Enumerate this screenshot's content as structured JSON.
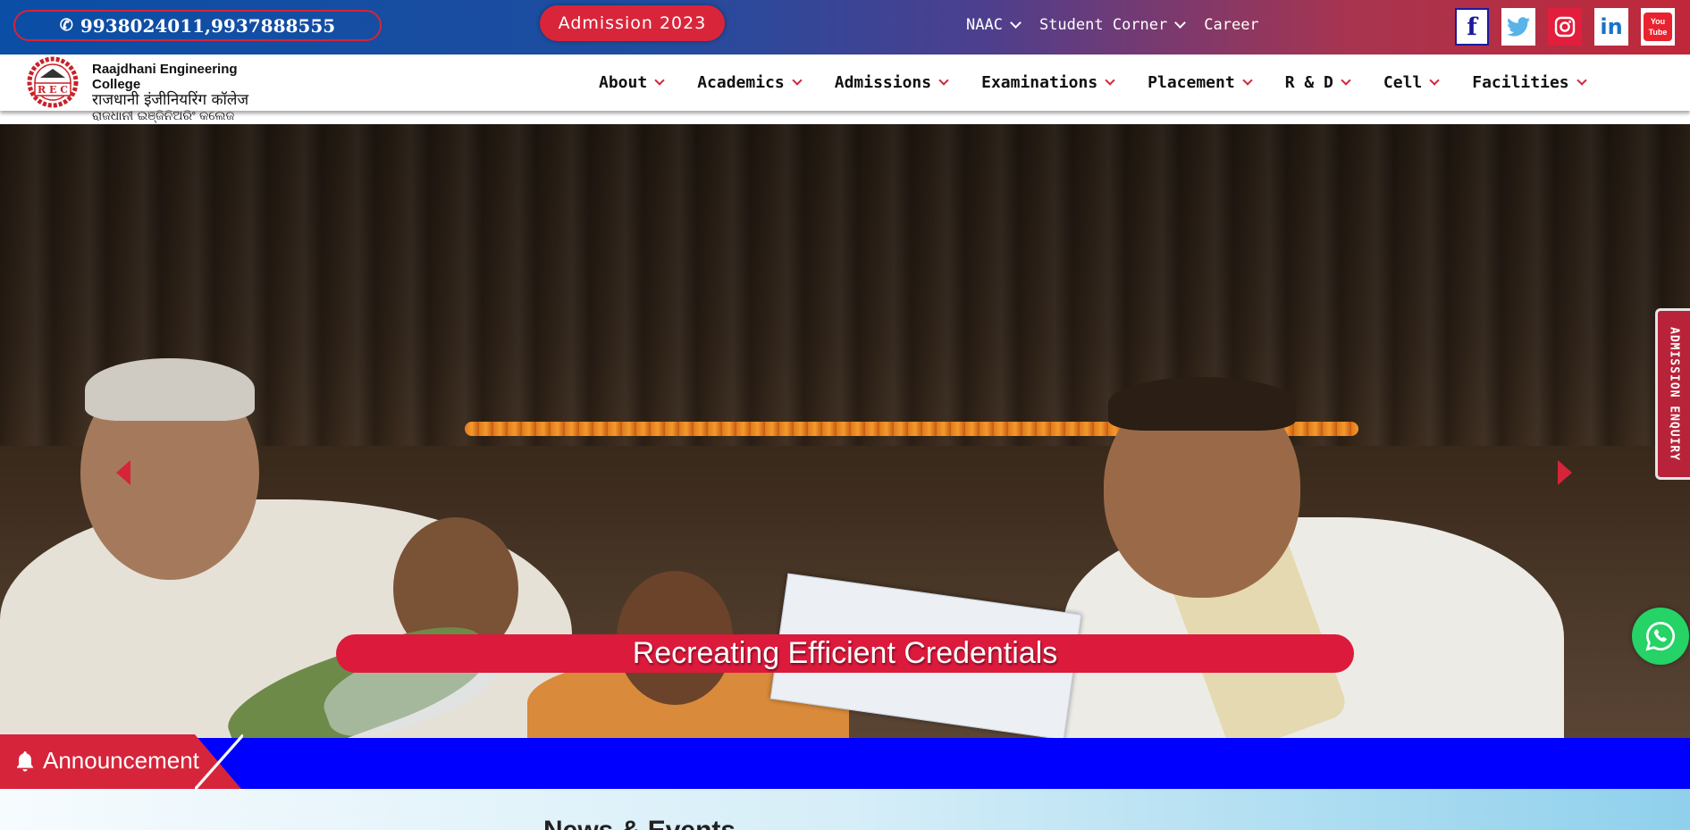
{
  "topbar": {
    "phone": "9938024011,9937888555",
    "admission_label": "Admission 2023",
    "links": [
      {
        "label": "NAAC",
        "has_dropdown": true
      },
      {
        "label": "Student Corner",
        "has_dropdown": true
      },
      {
        "label": "Career",
        "has_dropdown": false
      }
    ],
    "socials": [
      {
        "name": "facebook-icon",
        "glyph": "f"
      },
      {
        "name": "twitter-icon",
        "glyph": ""
      },
      {
        "name": "instagram-icon",
        "glyph": ""
      },
      {
        "name": "linkedin-icon",
        "glyph": "in"
      },
      {
        "name": "youtube-icon",
        "glyph": "You Tube"
      }
    ]
  },
  "logo": {
    "emblem": "R E C",
    "line1": "Raajdhani Engineering College",
    "line2": "राजधानी इंजीनियरिंग कॉलेज",
    "line3": "ରାଜଧାନୀ ଇଞ୍ଜିନିଅରିଂ କଲେଜ"
  },
  "nav": {
    "items": [
      "About",
      "Academics",
      "Admissions",
      "Examinations",
      "Placement",
      "R & D",
      "Cell",
      "Facilities"
    ]
  },
  "hero": {
    "caption": "Recreating Efficient Credentials"
  },
  "side": {
    "enquiry_label": "ADMISSION ENQUIRY"
  },
  "announcement": {
    "label": "Announcement"
  },
  "news": {
    "title": "News & Events"
  },
  "colors": {
    "accent_red": "#d6243a",
    "announcement_blue": "#0000ff",
    "whatsapp_green": "#25d366"
  }
}
